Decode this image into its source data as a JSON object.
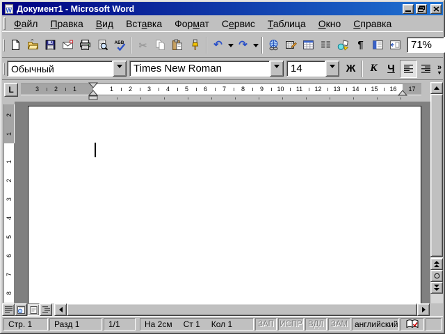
{
  "window": {
    "title": "Документ1 - Microsoft Word"
  },
  "menu": {
    "items": [
      {
        "pre": "",
        "key": "Ф",
        "post": "айл"
      },
      {
        "pre": "",
        "key": "П",
        "post": "равка"
      },
      {
        "pre": "",
        "key": "В",
        "post": "ид"
      },
      {
        "pre": "Вст",
        "key": "а",
        "post": "вка"
      },
      {
        "pre": "Фор",
        "key": "м",
        "post": "ат"
      },
      {
        "pre": "С",
        "key": "е",
        "post": "рвис"
      },
      {
        "pre": "",
        "key": "Т",
        "post": "аблица"
      },
      {
        "pre": "",
        "key": "О",
        "post": "кно"
      },
      {
        "pre": "",
        "key": "С",
        "post": "правка"
      }
    ]
  },
  "standard_toolbar": {
    "zoom_value": "71%",
    "more_buttons": "»",
    "more_arrow": "▾"
  },
  "formatting_toolbar": {
    "style": "Обычный",
    "font": "Times New Roman",
    "size": "14",
    "bold_label": "Ж",
    "italic_label": "К",
    "underline_label": "Ч",
    "more_buttons": "»",
    "more_arrow": "▾"
  },
  "icons": {
    "pilcrow": "¶",
    "undo_arrow": "↶",
    "redo_arrow": "↷",
    "cut_glyph": "✂",
    "tab_selector": "L"
  },
  "ruler": {
    "h_margin_left": [
      "3",
      "2",
      "1"
    ],
    "h_text_area": [
      "1",
      "2",
      "3",
      "4",
      "5",
      "6",
      "7",
      "8",
      "9",
      "10",
      "11",
      "12",
      "13",
      "14",
      "15",
      "16"
    ],
    "h_margin_right": [
      "17"
    ],
    "v_margin_top": [
      "2",
      "1"
    ],
    "v_text_area": [
      "1",
      "2",
      "3",
      "4",
      "5",
      "6",
      "7",
      "8"
    ]
  },
  "status_bar": {
    "page": "Стр. 1",
    "section": "Разд 1",
    "page_count": "1/1",
    "position": "На 2см",
    "line": "Ст 1",
    "column": "Кол 1",
    "record_macro": "ЗАП",
    "track_changes": "ИСПР",
    "extend_selection": "ВДЛ",
    "overtype": "ЗАМ",
    "language": "английский"
  },
  "colors": {
    "titlebar_from": "#000080",
    "titlebar_to": "#1f72d2",
    "chrome": "#c0c0c0",
    "desktop": "#808080",
    "accent_blue": "#2a50c8"
  }
}
